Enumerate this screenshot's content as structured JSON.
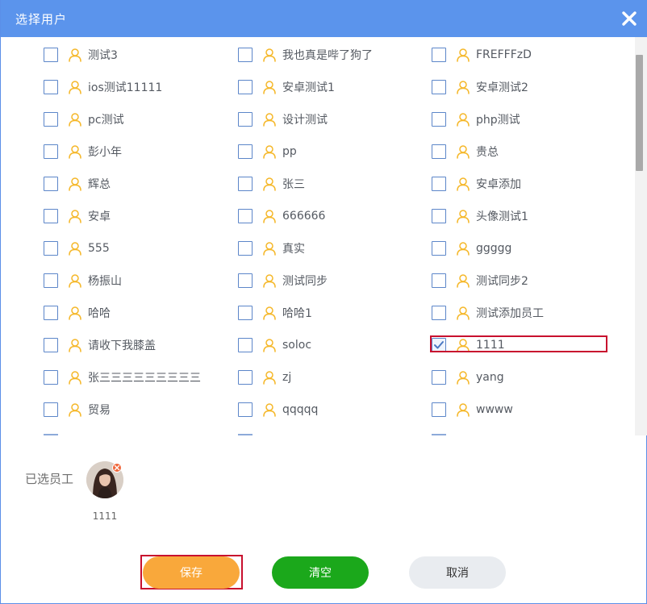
{
  "dialog": {
    "title": "选择用户"
  },
  "users": [
    [
      "测试3",
      "我也真是哔了狗了",
      "FREFFFzD"
    ],
    [
      "ios测试11111",
      "安卓测试1",
      "安卓测试2"
    ],
    [
      "pc测试",
      "设计测试",
      "php测试"
    ],
    [
      "彭小年",
      "pp",
      "贵总"
    ],
    [
      "辉总",
      "张三",
      "安卓添加"
    ],
    [
      "安卓",
      "666666",
      "头像测试1"
    ],
    [
      "555",
      "真实",
      "ggggg"
    ],
    [
      "杨振山",
      "测试同步",
      "测试同步2"
    ],
    [
      "哈哈",
      "哈哈1",
      "测试添加员工"
    ],
    [
      "请收下我膝盖",
      "soloc",
      "1111"
    ],
    [
      "张三三三三三三三三三",
      "zj",
      "yang"
    ],
    [
      "贸易",
      "qqqqq",
      "wwww"
    ]
  ],
  "checked": [
    [
      9,
      2
    ]
  ],
  "selected": {
    "label": "已选员工",
    "employees": [
      {
        "name": "1111"
      }
    ]
  },
  "buttons": {
    "save": "保存",
    "clear": "清空",
    "cancel": "取消"
  },
  "colors": {
    "titlebar": "#5b94ec",
    "save": "#f9a83b",
    "clear": "#1ba81b",
    "cancel": "#e9ecf0",
    "user_icon": "#f5b728",
    "highlight": "#c8102e"
  },
  "icons": {
    "close": "close-icon",
    "user": "user-icon",
    "check": "check-icon",
    "remove": "remove-icon"
  }
}
